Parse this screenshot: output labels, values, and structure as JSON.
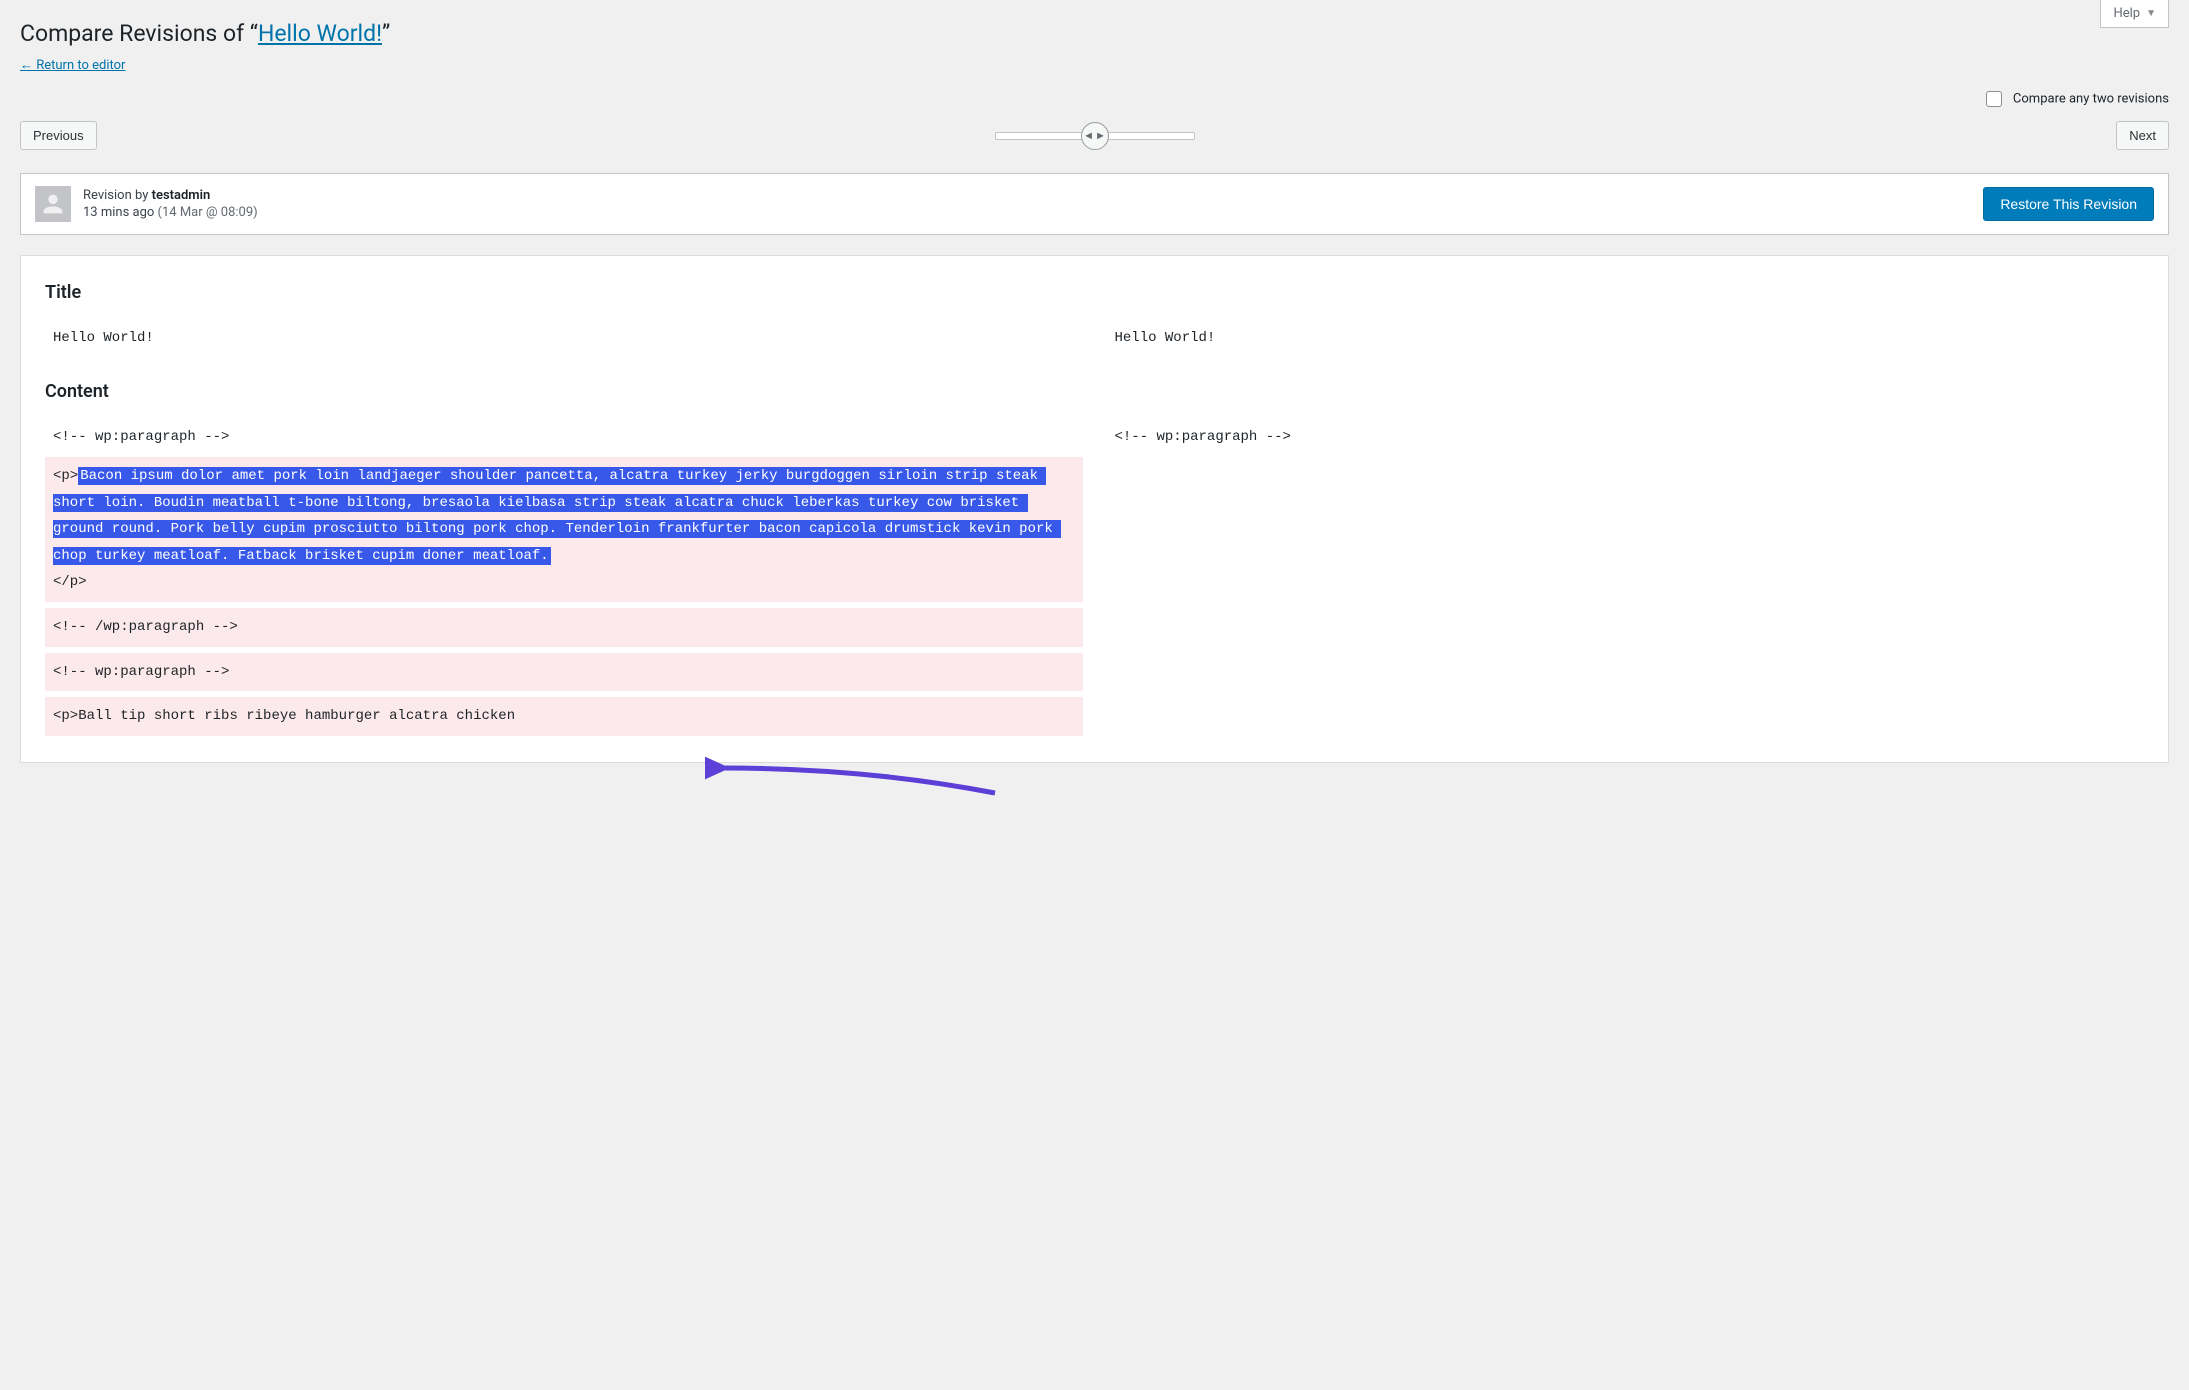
{
  "help": {
    "label": "Help"
  },
  "header": {
    "title_prefix": "Compare Revisions of “",
    "title_link": "Hello World!",
    "title_suffix": "”",
    "return_link": "← Return to editor"
  },
  "compare_toggle": {
    "label": "Compare any two revisions",
    "checked": false
  },
  "nav": {
    "previous": "Previous",
    "next": "Next"
  },
  "revision_meta": {
    "by_label": "Revision by ",
    "author": "testadmin",
    "time_relative": "13 mins ago",
    "timestamp": "(14 Mar @ 08:09)",
    "restore_button": "Restore This Revision"
  },
  "diff": {
    "title_heading": "Title",
    "title_left": "Hello World!",
    "title_right": "Hello World!",
    "content_heading": "Content",
    "left": {
      "line1_plain": "<!-- wp:paragraph -->",
      "block_open": "<p>",
      "block_highlight": "Bacon ipsum dolor amet pork loin landjaeger shoulder pancetta, alcatra turkey jerky burgdoggen sirloin strip steak short loin. Boudin meatball t-bone biltong, bresaola kielbasa strip steak alcatra chuck leberkas turkey cow brisket ground round. Pork belly cupim prosciutto biltong pork chop. Tenderloin frankfurter bacon capicola drumstick kevin pork chop turkey meatloaf. Fatback brisket cupim doner meatloaf.",
      "block_close": "</p>",
      "line3": "<!-- /wp:paragraph -->",
      "line4": "<!-- wp:paragraph -->",
      "line5_open": "<p>",
      "line5_text": "Ball tip short ribs ribeye hamburger alcatra chicken"
    },
    "right": {
      "line1_plain": "<!-- wp:paragraph -->"
    }
  }
}
